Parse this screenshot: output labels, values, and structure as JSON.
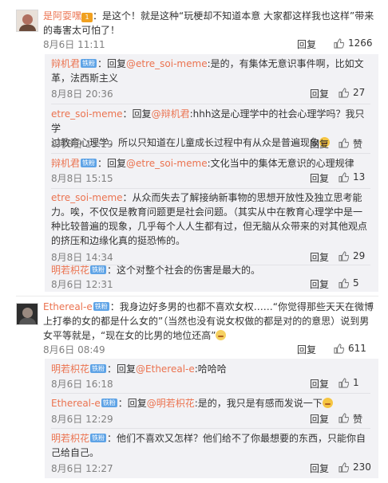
{
  "comments": [
    {
      "user": "是阿耍嘿",
      "vip": "1",
      "body_lines": [
        "：是这个！就是这种“玩梗却不知道本意 大家都这样我也这样”带来",
        "的毒害太可怕了！"
      ],
      "time": "8月6日 11:11",
      "reply": "回复",
      "likes": "1266",
      "replies": [
        {
          "user": "辩机君",
          "badge": "铁粉",
          "lines": [
            "：回复",
            "@etre_soi-meme",
            ":是的，有集体无意识事件啊，比如文",
            "革，法西斯主义"
          ],
          "time": "8月8日 20:36",
          "reply": "回复",
          "likes": "27"
        },
        {
          "user": "etre_soi-meme",
          "badge": "",
          "lines": [
            "：回复",
            "@辩机君",
            ":hhh这是心理学中的社会心理学吗？我只学",
            "过教育心理学，所以只知道在儿童成长过程中有从众是普遍现象"
          ],
          "time": "8月8日 15:19",
          "reply": "回复",
          "likes": "赞"
        },
        {
          "user": "辩机君",
          "badge": "铁粉",
          "lines": [
            "：回复",
            "@etre_soi-meme",
            ":文化当中的集体无意识的心理规律"
          ],
          "time": "8月8日 15:15",
          "reply": "回复",
          "likes": "13"
        },
        {
          "user": "etre_soi-meme",
          "badge": "",
          "lines": [
            "：从众而失去了解接纳新事物的思想开放性及独立思考能",
            "力。唉，不仅仅是教育问题更是社会问题。（其实从中在教育心理学中是一",
            "种比较普遍的现象，几乎每个人人生都有过，但无脑从众带来的对其他观点",
            "的挤压和边缘化真的挺恐怖的。"
          ],
          "time": "8月8日 14:34",
          "reply": "回复",
          "likes": "29"
        },
        {
          "user": "明若枳花",
          "badge": "铁粉",
          "lines": [
            "：这个对整个社会的伤害是最大的。"
          ],
          "time": "8月6日 12:31",
          "reply": "回复",
          "likes": "5"
        }
      ]
    },
    {
      "user": "Ethereal-e",
      "badge": "铁粉",
      "body_lines": [
        "：我身边好多男的也都不喜欢女权……“你觉得那些天天在微博",
        "上打拳的女的都是什么女的”（当然也没有说女权做的都是对的的意思）说到男",
        "女平等就是，“现在女的比男的地位还高”"
      ],
      "time": "8月6日 08:49",
      "reply": "回复",
      "likes": "611",
      "replies": [
        {
          "user": "明若枳花",
          "badge": "铁粉",
          "lines": [
            "：回复",
            "@Ethereal-e",
            ":哈哈哈"
          ],
          "time": "8月6日 16:18",
          "reply": "回复",
          "likes": "1"
        },
        {
          "user": "Ethereal-e",
          "badge": "铁粉",
          "lines": [
            "：回复",
            "@明若枳花",
            ":是的，我只是有感而发说一下"
          ],
          "time": "8月6日 12:29",
          "reply": "回复",
          "likes": "赞"
        },
        {
          "user": "明若枳花",
          "badge": "铁粉",
          "lines": [
            "：他们不喜欢又怎样？他们给不了你最想要的东西，只能你自",
            "己给自己。"
          ],
          "time": "8月6日 12:27",
          "reply": "回复",
          "likes": "230"
        }
      ]
    }
  ],
  "colors": {
    "username": "#eb7350",
    "meta": "#808080",
    "sub_bg": "#f2f2f5",
    "badge": "#5ea3e6"
  },
  "icons": {
    "like": "thumbs-up-icon",
    "vip": "vip-badge-icon",
    "fan": "fan-badge-icon",
    "emoji": "laugh-emoji-icon",
    "emoji2": "sweat-emoji-icon"
  }
}
